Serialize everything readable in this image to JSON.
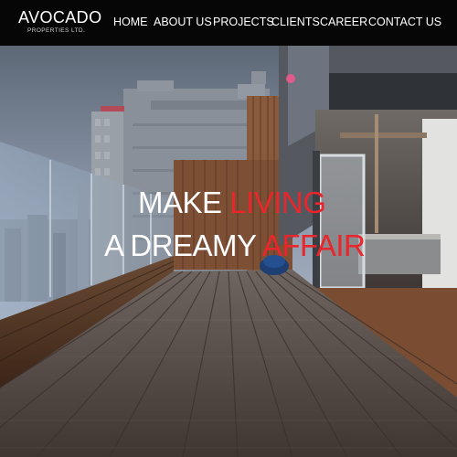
{
  "brand": {
    "name": "AVOCADO",
    "tagline": "PROPERTIES LTD."
  },
  "nav": {
    "items": [
      "HOME",
      "ABOUT US",
      "PROJECTS",
      "CLIENTS",
      "CAREER",
      "CONTACT US"
    ]
  },
  "hero": {
    "line1_white": "MAKE",
    "line1_red": "LIVING",
    "line2_white": "A DREAMY",
    "line2_red": "AFFAIR"
  },
  "colors": {
    "header_bg": "#060606",
    "accent_red": "#e8262b",
    "text": "#ffffff"
  }
}
